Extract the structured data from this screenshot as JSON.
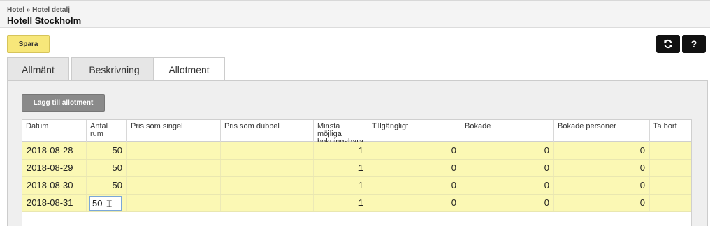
{
  "header": {
    "breadcrumb": {
      "root": "Hotel",
      "separator": "»",
      "current": "Hotel detalj"
    },
    "title": "Hotell Stockholm"
  },
  "toolbar": {
    "save_label": "Spara",
    "refresh_icon": "refresh-icon",
    "help_label": "?"
  },
  "tabs": [
    {
      "label": "Allmänt",
      "active": false
    },
    {
      "label": "Beskrivning",
      "active": false
    },
    {
      "label": "Allotment",
      "active": true
    }
  ],
  "allotment": {
    "add_label": "Lägg till allotment",
    "columns": [
      "Datum",
      "Antal rum",
      "Pris som singel",
      "Pris som dubbel",
      "Minsta möjliga bokningsbara",
      "Tillgängligt",
      "Bokade",
      "Bokade personer",
      "Ta bort"
    ],
    "rows": [
      {
        "date": "2018-08-28",
        "rooms": "50",
        "single": "",
        "double": "",
        "min": "1",
        "available": "0",
        "booked": "0",
        "booked_persons": "0"
      },
      {
        "date": "2018-08-29",
        "rooms": "50",
        "single": "",
        "double": "",
        "min": "1",
        "available": "0",
        "booked": "0",
        "booked_persons": "0"
      },
      {
        "date": "2018-08-30",
        "rooms": "50",
        "single": "",
        "double": "",
        "min": "1",
        "available": "0",
        "booked": "0",
        "booked_persons": "0"
      },
      {
        "date": "2018-08-31",
        "rooms": "50",
        "single": "",
        "double": "",
        "min": "1",
        "available": "0",
        "booked": "0",
        "booked_persons": "0"
      }
    ]
  },
  "colors": {
    "save": "#f7e77a",
    "row_highlight": "#fbf8b4",
    "icon_button": "#111111",
    "add_button": "#8a8a8a"
  }
}
